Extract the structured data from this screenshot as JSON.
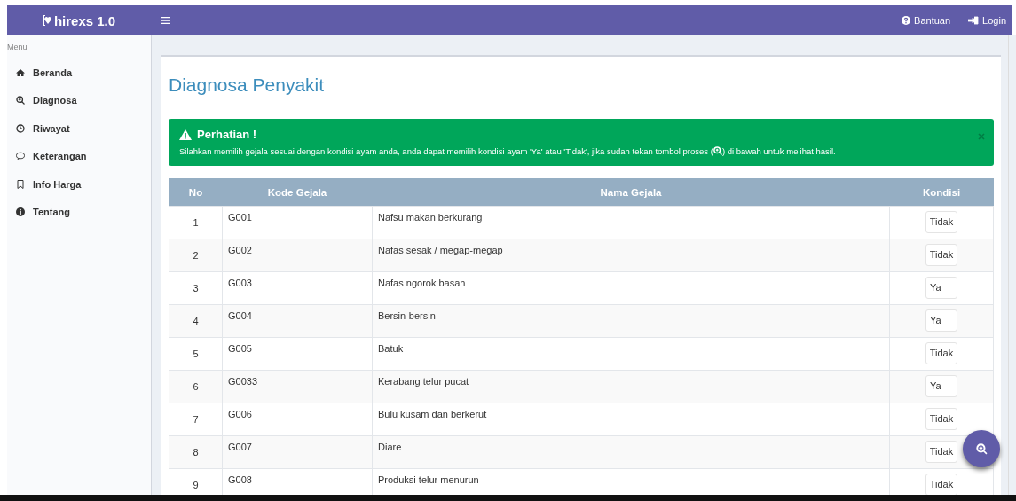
{
  "brand": "hirexs 1.0",
  "nav_right": [
    {
      "kind": "help",
      "label": "Bantuan"
    },
    {
      "kind": "login",
      "label": "Login"
    }
  ],
  "sidebar": {
    "header": "Menu",
    "items": [
      {
        "label": "Beranda",
        "selected": false
      },
      {
        "label": "Diagnosa",
        "selected": false
      },
      {
        "label": "Riwayat",
        "selected": false
      },
      {
        "label": "Keterangan",
        "selected": false
      },
      {
        "label": "Info Harga",
        "selected": false
      },
      {
        "label": "Tentang",
        "selected": false
      }
    ]
  },
  "page_title": "Diagnosa Penyakit",
  "alert": {
    "title": "Perhatian !",
    "text_before": "Silahkan memilih gejala sesuai dengan kondisi ayam anda, anda dapat memilih kondisi ayam 'Ya' atau 'Tidak', jika sudah tekan tombol proses (",
    "text_after": ") di bawah untuk melihat hasil."
  },
  "table": {
    "columns": [
      "No",
      "Kode Gejala",
      "Nama Gejala",
      "Kondisi"
    ],
    "rows": [
      {
        "no": "1",
        "code": "G001",
        "name": "Nafsu makan berkurang",
        "kondisi": "Tidak"
      },
      {
        "no": "2",
        "code": "G002",
        "name": "Nafas sesak / megap-megap",
        "kondisi": "Tidak"
      },
      {
        "no": "3",
        "code": "G003",
        "name": "Nafas ngorok basah",
        "kondisi": "Ya"
      },
      {
        "no": "4",
        "code": "G004",
        "name": "Bersin-bersin",
        "kondisi": "Ya"
      },
      {
        "no": "5",
        "code": "G005",
        "name": "Batuk",
        "kondisi": "Tidak"
      },
      {
        "no": "6",
        "code": "G0033",
        "name": "Kerabang telur pucat",
        "kondisi": "Ya"
      },
      {
        "no": "7",
        "code": "G006",
        "name": "Bulu kusam dan berkerut",
        "kondisi": "Tidak"
      },
      {
        "no": "8",
        "code": "G007",
        "name": "Diare",
        "kondisi": "Tidak"
      },
      {
        "no": "9",
        "code": "G008",
        "name": "Produksi telur menurun",
        "kondisi": "Tidak"
      }
    ]
  }
}
